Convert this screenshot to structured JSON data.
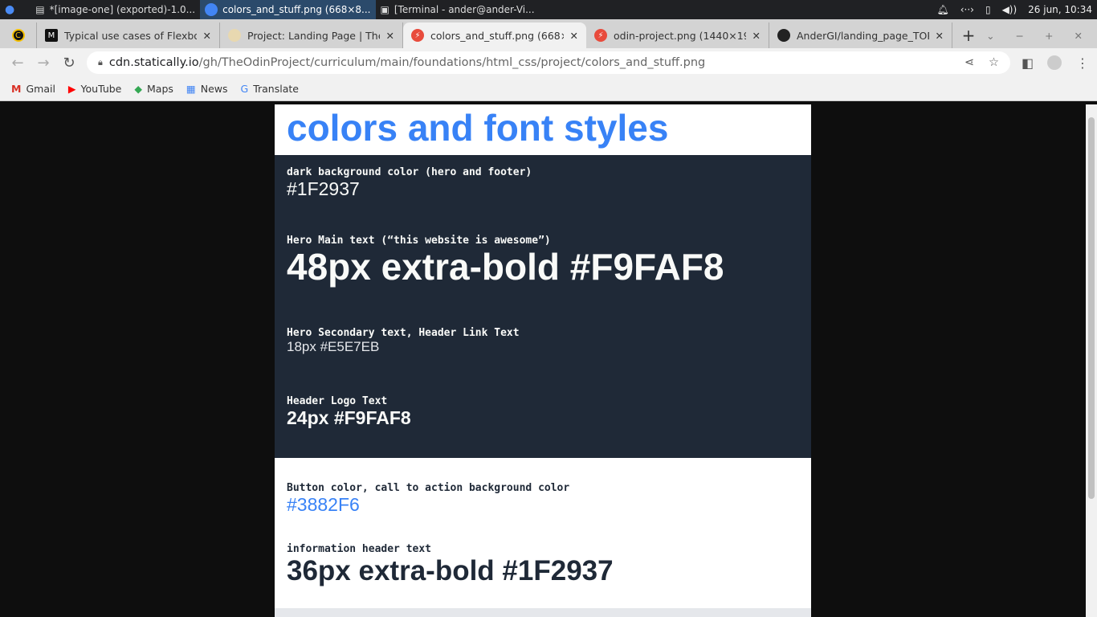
{
  "taskbar": {
    "items": [
      "*[image-one] (exported)-1.0...",
      "colors_and_stuff.png (668×8...",
      "[Terminal - ander@ander-Vi..."
    ],
    "clock": "26 jun, 10:34"
  },
  "tabs": [
    {
      "title": "Typical use cases of Flexbox"
    },
    {
      "title": "Project: Landing Page | The"
    },
    {
      "title": "colors_and_stuff.png (668×8"
    },
    {
      "title": "odin-project.png (1440×191"
    },
    {
      "title": "AnderGI/landing_page_TOP"
    }
  ],
  "address": {
    "host": "cdn.statically.io",
    "path": "/gh/TheOdinProject/curriculum/main/foundations/html_css/project/colors_and_stuff.png"
  },
  "bookmarks": [
    "Gmail",
    "YouTube",
    "Maps",
    "News",
    "Translate"
  ],
  "content": {
    "title": "colors and font styles",
    "dark": [
      {
        "label": "dark background color (hero and footer)",
        "value": "#1F2937"
      },
      {
        "label": "Hero Main text (“this website is awesome”)",
        "value": "48px extra-bold #F9FAF8"
      },
      {
        "label": "Hero Secondary text, Header Link Text",
        "value": "18px #E5E7EB"
      },
      {
        "label": "Header Logo Text",
        "value": "24px #F9FAF8"
      }
    ],
    "light": [
      {
        "label": "Button color, call to action background color",
        "value": "#3882F6"
      },
      {
        "label": "information header text",
        "value": "36px extra-bold #1F2937"
      }
    ]
  },
  "colors": {
    "accent": "#3882F6",
    "dark": "#1F2937",
    "light": "#F9FAF8"
  }
}
